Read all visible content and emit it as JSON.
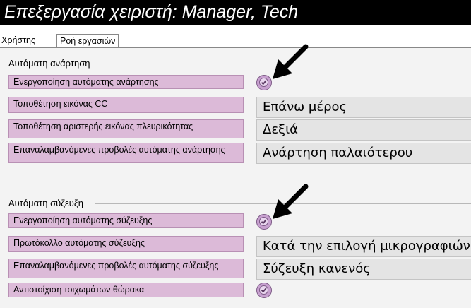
{
  "window": {
    "title": "Επεξεργασία χειριστή: Manager, Tech"
  },
  "tabs": [
    {
      "label": "Χρήστης"
    },
    {
      "label": "Ροή εργασιών"
    }
  ],
  "auto_hang": {
    "heading": "Αυτόματη ανάρτηση",
    "rows": [
      {
        "label": "Ενεργοποίηση αυτόματης ανάρτησης",
        "checked": true,
        "icon": "check-circle-icon"
      },
      {
        "label": "Τοποθέτηση εικόνας CC",
        "value": "Επάνω μέρος"
      },
      {
        "label": "Τοποθέτηση αριστερής εικόνας πλευρικότητας",
        "value": "Δεξιά"
      },
      {
        "label": "Επαναλαμβανόμενες προβολές αυτόματης ανάρτησης",
        "value": "Ανάρτηση παλαιότερου"
      }
    ]
  },
  "auto_pair": {
    "heading": "Αυτόματη σύζευξη",
    "rows": [
      {
        "label": "Ενεργοποίηση αυτόματης σύζευξης",
        "checked": true,
        "icon": "check-circle-icon"
      },
      {
        "label": "Πρωτόκολλο αυτόματης σύζευξης",
        "value": "Κατά την επιλογή μικρογραφιών"
      },
      {
        "label": "Επαναλαμβανόμενες προβολές αυτόματης σύζευξης",
        "value": "Σύζευξη κανενός"
      },
      {
        "label": "Αντιστοίχιση τοιχωμάτων θώρακα",
        "checked": true,
        "icon": "check-circle-icon"
      }
    ]
  },
  "colors": {
    "label_bg": "#dcbad8",
    "check_fill": "#c7a0cf",
    "value_bg": "#e4e4e4"
  }
}
